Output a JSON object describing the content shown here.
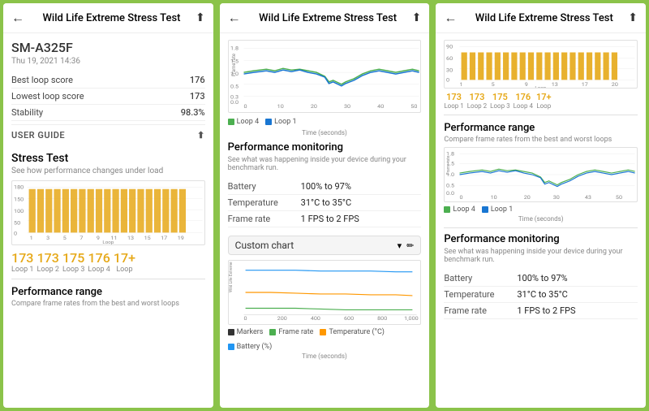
{
  "app": {
    "title": "Wild Life Extreme Stress Test"
  },
  "panel1": {
    "header": {
      "title": "Wild Life Extreme Stress Test",
      "back_label": "←",
      "share_label": "⬆"
    },
    "device": "SM-A325F",
    "date": "Thu 19, 2021 14:36",
    "best_loop_label": "Best loop score",
    "best_loop_val": "176",
    "lowest_loop_label": "Lowest loop score",
    "lowest_loop_val": "173",
    "stability_label": "Stability",
    "stability_val": "98.3%",
    "user_guide_label": "USER GUIDE",
    "stress_test_title": "Stress Test",
    "stress_test_sub": "See how performance changes under load",
    "loop_scores": [
      {
        "score": "173",
        "label": "Loop 1"
      },
      {
        "score": "173",
        "label": "Loop 2"
      },
      {
        "score": "175",
        "label": "Loop 3"
      },
      {
        "score": "176",
        "label": "Loop 4"
      },
      {
        "score": "17+",
        "label": "Loop"
      }
    ],
    "perf_range_title": "Performance range",
    "perf_range_sub": "Compare frame rates from the best and worst loops"
  },
  "panel2": {
    "header": {
      "title": "Wild Life Extreme Stress Test",
      "back_label": "←",
      "share_label": "⬆"
    },
    "line_chart_x_label": "Time (seconds)",
    "line_chart_y_label": "Frame rate",
    "perf_monitoring_title": "Performance monitoring",
    "perf_monitoring_sub": "See what was happening inside your device during your benchmark run.",
    "battery_label": "Battery",
    "battery_val": "100% to 97%",
    "temperature_label": "Temperature",
    "temperature_val": "31°C to 35°C",
    "frame_rate_label": "Frame rate",
    "frame_rate_val": "1 FPS to 2 FPS",
    "custom_chart_label": "Custom chart",
    "dropdown_icon": "▾",
    "edit_icon": "✏",
    "bar_chart_x_label": "Time (seconds)",
    "bar_chart_y_label": "Wild Life Extreme Stress Test",
    "legend": [
      {
        "color": "#333",
        "label": "Markers"
      },
      {
        "color": "#4caf50",
        "label": "Frame rate"
      },
      {
        "color": "#ff9800",
        "label": "Temperature (°C)"
      },
      {
        "color": "#2196f3",
        "label": "Battery (%)"
      }
    ]
  },
  "panel3": {
    "header": {
      "title": "Wild Life Extreme Stress Test",
      "back_label": "←",
      "share_label": "⬆"
    },
    "loop_scores": [
      {
        "score": "173",
        "label": "Loop 1"
      },
      {
        "score": "173",
        "label": "Loop 2"
      },
      {
        "score": "175",
        "label": "Loop 3"
      },
      {
        "score": "176",
        "label": "Loop 4"
      },
      {
        "score": "17+",
        "label": "Loop"
      }
    ],
    "perf_range_title": "Performance range",
    "perf_range_sub": "Compare frame rates from the best and worst loops",
    "line_chart_x_label": "Time (seconds)",
    "perf_monitoring_title": "Performance monitoring",
    "perf_monitoring_sub": "See what was happening inside your device during your benchmark run.",
    "battery_label": "Battery",
    "battery_val": "100% to 97%",
    "temperature_label": "Temperature",
    "temperature_val": "31°C to 35°C",
    "frame_rate_label": "Frame rate",
    "frame_rate_val": "1 FPS to 2 FPS"
  },
  "colors": {
    "accent": "#e6a817",
    "green": "#8bc34a",
    "line1": "#4caf50",
    "line2": "#1976d2",
    "chart_bg": "#fff",
    "battery": "#2196f3",
    "temperature": "#ff9800",
    "framerate": "#4caf50"
  }
}
